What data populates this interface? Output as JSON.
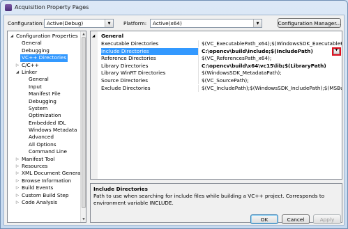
{
  "window": {
    "title": "Acquisition Property Pages"
  },
  "toolbar": {
    "configuration_label": "Configuration:",
    "configuration_value": "Active(Debug)",
    "platform_label": "Platform:",
    "platform_value": "Active(x64)",
    "manager_button": "Configuration Manager..."
  },
  "tree": {
    "items": [
      {
        "label": "Configuration Properties",
        "expander": "◢",
        "level": 0
      },
      {
        "label": "General",
        "expander": "",
        "level": 1
      },
      {
        "label": "Debugging",
        "expander": "",
        "level": 1
      },
      {
        "label": "VC++ Directories",
        "expander": "",
        "level": 1,
        "selected": true
      },
      {
        "label": "C/C++",
        "expander": "▷",
        "level": 1
      },
      {
        "label": "Linker",
        "expander": "◢",
        "level": 1
      },
      {
        "label": "General",
        "expander": "",
        "level": 2
      },
      {
        "label": "Input",
        "expander": "",
        "level": 2
      },
      {
        "label": "Manifest File",
        "expander": "",
        "level": 2
      },
      {
        "label": "Debugging",
        "expander": "",
        "level": 2
      },
      {
        "label": "System",
        "expander": "",
        "level": 2
      },
      {
        "label": "Optimization",
        "expander": "",
        "level": 2
      },
      {
        "label": "Embedded IDL",
        "expander": "",
        "level": 2
      },
      {
        "label": "Windows Metadata",
        "expander": "",
        "level": 2
      },
      {
        "label": "Advanced",
        "expander": "",
        "level": 2
      },
      {
        "label": "All Options",
        "expander": "",
        "level": 2
      },
      {
        "label": "Command Line",
        "expander": "",
        "level": 2
      },
      {
        "label": "Manifest Tool",
        "expander": "▷",
        "level": 1
      },
      {
        "label": "Resources",
        "expander": "▷",
        "level": 1
      },
      {
        "label": "XML Document Genera",
        "expander": "▷",
        "level": 1
      },
      {
        "label": "Browse Information",
        "expander": "▷",
        "level": 1
      },
      {
        "label": "Build Events",
        "expander": "▷",
        "level": 1
      },
      {
        "label": "Custom Build Step",
        "expander": "▷",
        "level": 1
      },
      {
        "label": "Code Analysis",
        "expander": "▷",
        "level": 1
      }
    ]
  },
  "grid": {
    "category": "General",
    "rows": [
      {
        "name": "Executable Directories",
        "value": "$(VC_ExecutablePath_x64);$(WindowsSDK_ExecutablePath);$(VS_Exe",
        "bold": false
      },
      {
        "name": "Include Directories",
        "value": "C:\\opencv\\build\\include;$(IncludePath)",
        "bold": true,
        "selected": true
      },
      {
        "name": "Reference Directories",
        "value": "$(VC_ReferencesPath_x64);",
        "bold": false
      },
      {
        "name": "Library Directories",
        "value": "C:\\opencv\\build\\x64\\vc15\\lib;$(LibraryPath)",
        "bold": true
      },
      {
        "name": "Library WinRT Directories",
        "value": "$(WindowsSDK_MetadataPath);",
        "bold": false
      },
      {
        "name": "Source Directories",
        "value": "$(VC_SourcePath);",
        "bold": false
      },
      {
        "name": "Exclude Directories",
        "value": "$(VC_IncludePath);$(WindowsSDK_IncludePath);$(MSBuild_Executa",
        "bold": false
      }
    ]
  },
  "description": {
    "title": "Include Directories",
    "text": "Path to use when searching for include files while building a VC++ project.  Corresponds to environment variable INCLUDE."
  },
  "buttons": {
    "ok": "OK",
    "cancel": "Cancel",
    "apply": "Apply"
  },
  "colors": {
    "selection": "#3399ff",
    "highlight_box": "#e0101f"
  }
}
